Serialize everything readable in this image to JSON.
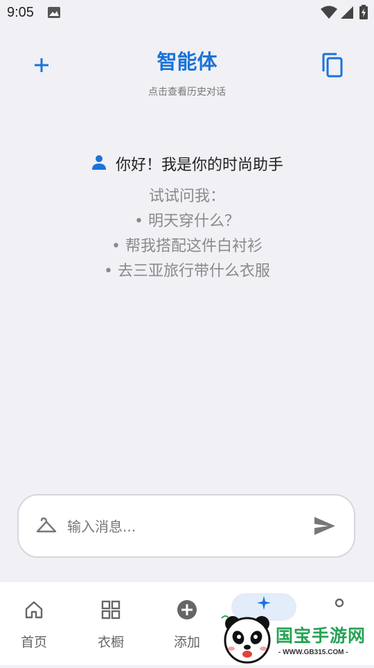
{
  "status_bar": {
    "time": "9:05"
  },
  "header": {
    "title": "智能体",
    "subtitle": "点击查看历史对话",
    "new_chat_icon": "plus-icon",
    "history_icon": "copy-icon"
  },
  "welcome": {
    "greeting": "你好！我是你的时尚助手",
    "prompt": "试试问我：",
    "suggestions": [
      "• 明天穿什么？",
      "• 帮我搭配这件白衬衫",
      "• 去三亚旅行带什么衣服"
    ]
  },
  "input": {
    "placeholder": "输入消息...",
    "value": ""
  },
  "bottom_nav": {
    "items": [
      {
        "label": "首页",
        "icon": "home-icon"
      },
      {
        "label": "衣橱",
        "icon": "grid-icon"
      },
      {
        "label": "添加",
        "icon": "add-circle-icon"
      }
    ]
  },
  "watermark": {
    "brand": "国宝手游网",
    "url": "- WWW.GB315.COM -"
  },
  "colors": {
    "accent": "#1a73d9",
    "background": "#f0f0f5",
    "nav_background": "#ffffff",
    "muted_text": "#8a8a8a",
    "watermark_green": "#26a354"
  }
}
